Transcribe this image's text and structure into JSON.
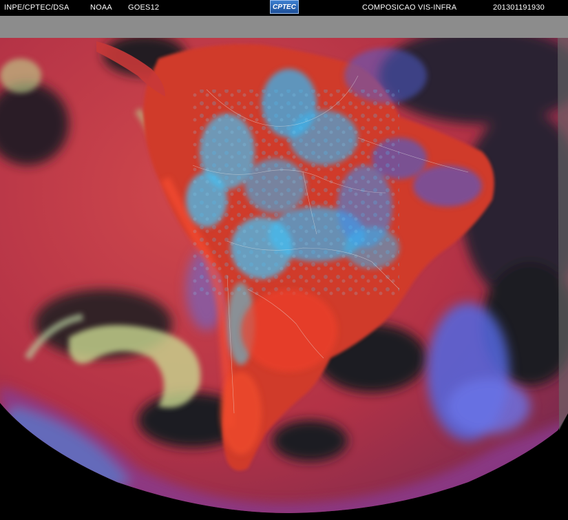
{
  "header": {
    "source_label": "INPE/CPTEC/DSA",
    "agency_label": "NOAA",
    "satellite_label": "GOES12",
    "logo_text": "CPTEC",
    "product_label": "COMPOSICAO VIS-INFRA",
    "timestamp_label": "201301191930"
  },
  "image": {
    "description": "GOES-12 false-color visible/infrared composite over South America",
    "palette": {
      "land_red": "#d03a2c",
      "ocean_red": "#b83848",
      "cloud_cyan": "#3ab4ee",
      "cloud_blue": "#5468e0",
      "cloud_yellow": "#c8d890",
      "dark_ocean": "#1e1c22",
      "space_gray": "#8a8a8a",
      "purple": "#8a3a8c"
    }
  }
}
